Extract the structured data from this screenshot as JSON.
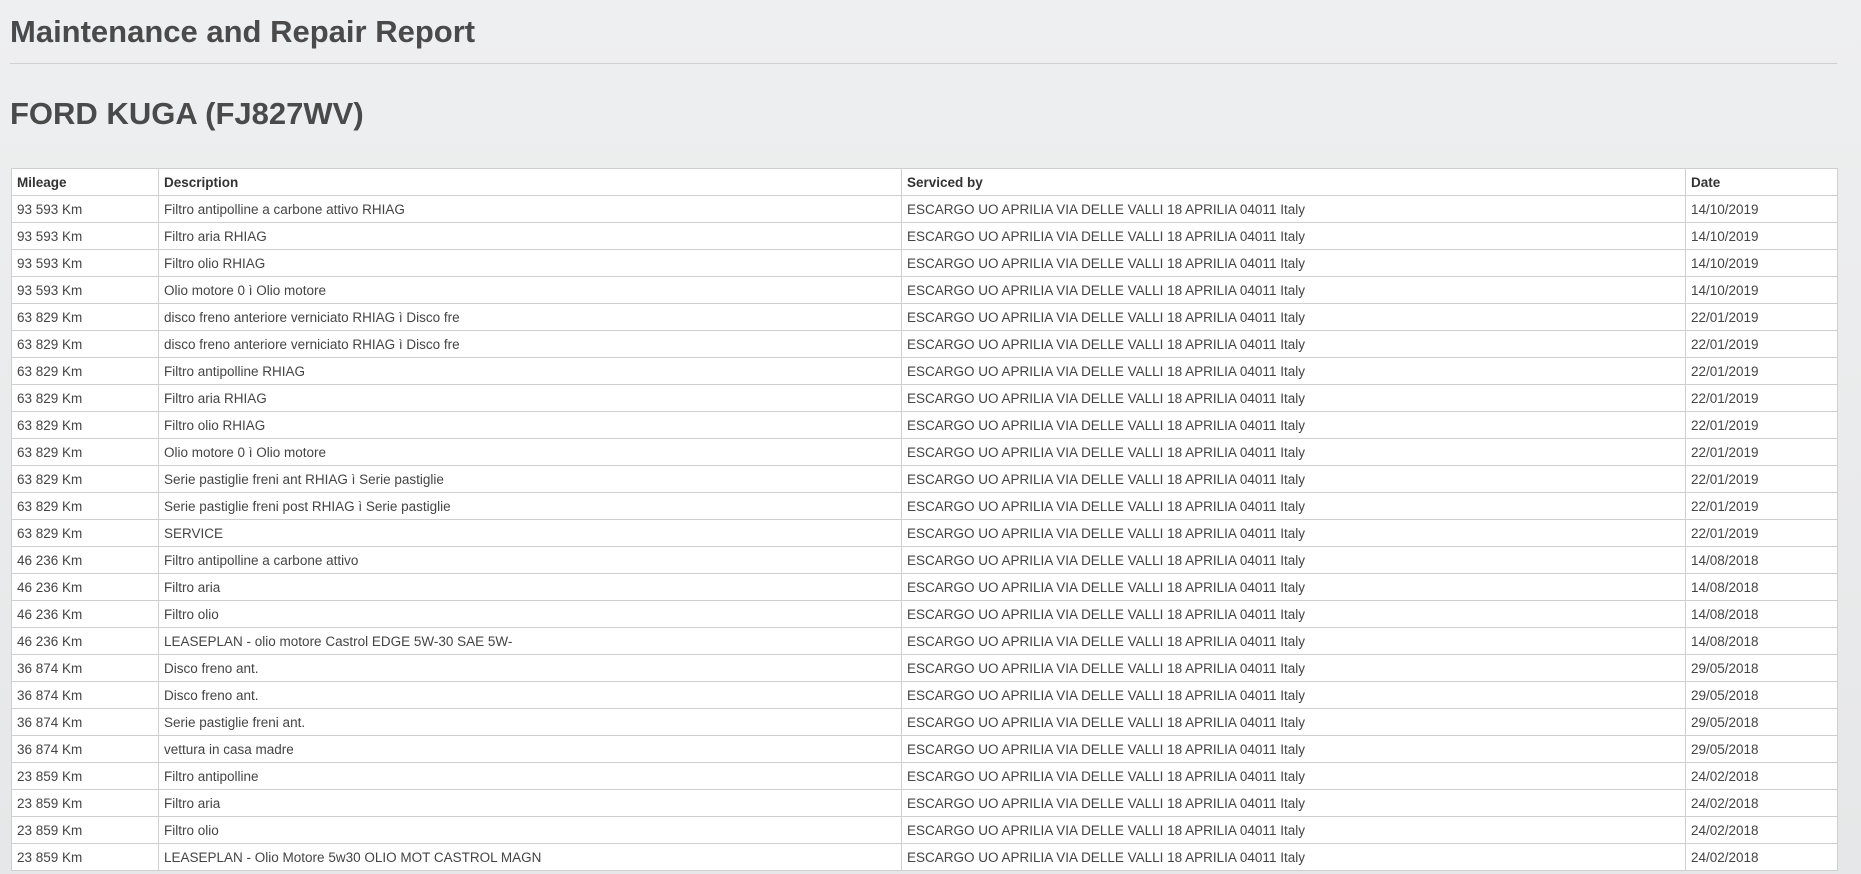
{
  "report": {
    "title": "Maintenance and Repair Report",
    "vehicle": "FORD KUGA (FJ827WV)"
  },
  "table": {
    "headers": {
      "mileage": "Mileage",
      "description": "Description",
      "serviced_by": "Serviced by",
      "date": "Date"
    },
    "rows": [
      {
        "mileage": "93 593 Km",
        "description": "Filtro antipolline a carbone attivo RHIAG",
        "serviced_by": "ESCARGO UO APRILIA VIA DELLE VALLI 18 APRILIA 04011 Italy",
        "date": "14/10/2019"
      },
      {
        "mileage": "93 593 Km",
        "description": "Filtro aria RHIAG",
        "serviced_by": "ESCARGO UO APRILIA VIA DELLE VALLI 18 APRILIA 04011 Italy",
        "date": "14/10/2019"
      },
      {
        "mileage": "93 593 Km",
        "description": "Filtro olio RHIAG",
        "serviced_by": "ESCARGO UO APRILIA VIA DELLE VALLI 18 APRILIA 04011 Italy",
        "date": "14/10/2019"
      },
      {
        "mileage": "93 593 Km",
        "description": "Olio motore 0 ì Olio motore",
        "serviced_by": "ESCARGO UO APRILIA VIA DELLE VALLI 18 APRILIA 04011 Italy",
        "date": "14/10/2019"
      },
      {
        "mileage": "63 829 Km",
        "description": "disco freno anteriore verniciato RHIAG ì Disco fre",
        "serviced_by": "ESCARGO UO APRILIA VIA DELLE VALLI 18 APRILIA 04011 Italy",
        "date": "22/01/2019"
      },
      {
        "mileage": "63 829 Km",
        "description": "disco freno anteriore verniciato RHIAG ì Disco fre",
        "serviced_by": "ESCARGO UO APRILIA VIA DELLE VALLI 18 APRILIA 04011 Italy",
        "date": "22/01/2019"
      },
      {
        "mileage": "63 829 Km",
        "description": "Filtro antipolline RHIAG",
        "serviced_by": "ESCARGO UO APRILIA VIA DELLE VALLI 18 APRILIA 04011 Italy",
        "date": "22/01/2019"
      },
      {
        "mileage": "63 829 Km",
        "description": "Filtro aria RHIAG",
        "serviced_by": "ESCARGO UO APRILIA VIA DELLE VALLI 18 APRILIA 04011 Italy",
        "date": "22/01/2019"
      },
      {
        "mileage": "63 829 Km",
        "description": "Filtro olio RHIAG",
        "serviced_by": "ESCARGO UO APRILIA VIA DELLE VALLI 18 APRILIA 04011 Italy",
        "date": "22/01/2019"
      },
      {
        "mileage": "63 829 Km",
        "description": "Olio motore 0 ì Olio motore",
        "serviced_by": "ESCARGO UO APRILIA VIA DELLE VALLI 18 APRILIA 04011 Italy",
        "date": "22/01/2019"
      },
      {
        "mileage": "63 829 Km",
        "description": "Serie pastiglie freni ant RHIAG ì Serie pastiglie",
        "serviced_by": "ESCARGO UO APRILIA VIA DELLE VALLI 18 APRILIA 04011 Italy",
        "date": "22/01/2019"
      },
      {
        "mileage": "63 829 Km",
        "description": "Serie pastiglie freni post RHIAG ì Serie pastiglie",
        "serviced_by": "ESCARGO UO APRILIA VIA DELLE VALLI 18 APRILIA 04011 Italy",
        "date": "22/01/2019"
      },
      {
        "mileage": "63 829 Km",
        "description": "SERVICE",
        "serviced_by": "ESCARGO UO APRILIA VIA DELLE VALLI 18 APRILIA 04011 Italy",
        "date": "22/01/2019"
      },
      {
        "mileage": "46 236 Km",
        "description": "Filtro antipolline a carbone attivo",
        "serviced_by": "ESCARGO UO APRILIA VIA DELLE VALLI 18 APRILIA 04011 Italy",
        "date": "14/08/2018"
      },
      {
        "mileage": "46 236 Km",
        "description": "Filtro aria",
        "serviced_by": "ESCARGO UO APRILIA VIA DELLE VALLI 18 APRILIA 04011 Italy",
        "date": "14/08/2018"
      },
      {
        "mileage": "46 236 Km",
        "description": "Filtro olio",
        "serviced_by": "ESCARGO UO APRILIA VIA DELLE VALLI 18 APRILIA 04011 Italy",
        "date": "14/08/2018"
      },
      {
        "mileage": "46 236 Km",
        "description": "LEASEPLAN - olio motore Castrol EDGE 5W-30 SAE 5W-",
        "serviced_by": "ESCARGO UO APRILIA VIA DELLE VALLI 18 APRILIA 04011 Italy",
        "date": "14/08/2018"
      },
      {
        "mileage": "36 874 Km",
        "description": "Disco freno ant.",
        "serviced_by": "ESCARGO UO APRILIA VIA DELLE VALLI 18 APRILIA 04011 Italy",
        "date": "29/05/2018"
      },
      {
        "mileage": "36 874 Km",
        "description": "Disco freno ant.",
        "serviced_by": "ESCARGO UO APRILIA VIA DELLE VALLI 18 APRILIA 04011 Italy",
        "date": "29/05/2018"
      },
      {
        "mileage": "36 874 Km",
        "description": "Serie pastiglie freni ant.",
        "serviced_by": "ESCARGO UO APRILIA VIA DELLE VALLI 18 APRILIA 04011 Italy",
        "date": "29/05/2018"
      },
      {
        "mileage": "36 874 Km",
        "description": "vettura in casa madre",
        "serviced_by": "ESCARGO UO APRILIA VIA DELLE VALLI 18 APRILIA 04011 Italy",
        "date": "29/05/2018"
      },
      {
        "mileage": "23 859 Km",
        "description": "Filtro antipolline",
        "serviced_by": "ESCARGO UO APRILIA VIA DELLE VALLI 18 APRILIA 04011 Italy",
        "date": "24/02/2018"
      },
      {
        "mileage": "23 859 Km",
        "description": "Filtro aria",
        "serviced_by": "ESCARGO UO APRILIA VIA DELLE VALLI 18 APRILIA 04011 Italy",
        "date": "24/02/2018"
      },
      {
        "mileage": "23 859 Km",
        "description": "Filtro olio",
        "serviced_by": "ESCARGO UO APRILIA VIA DELLE VALLI 18 APRILIA 04011 Italy",
        "date": "24/02/2018"
      },
      {
        "mileage": "23 859 Km",
        "description": "LEASEPLAN - Olio Motore 5w30 OLIO MOT CASTROL MAGN",
        "serviced_by": "ESCARGO UO APRILIA VIA DELLE VALLI 18 APRILIA 04011 Italy",
        "date": "24/02/2018"
      }
    ]
  }
}
